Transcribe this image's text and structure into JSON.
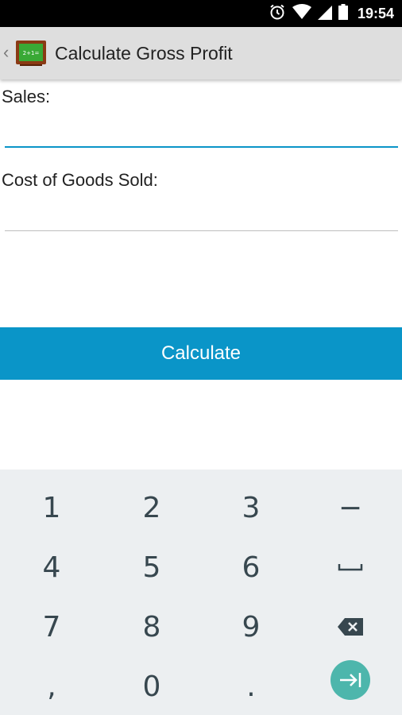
{
  "status_bar": {
    "time": "19:54",
    "icons": [
      "alarm-icon",
      "wifi-icon",
      "signal-icon",
      "battery-icon"
    ]
  },
  "action_bar": {
    "title": "Calculate Gross Profit",
    "app_icon_text": "2+1="
  },
  "form": {
    "sales_label": "Sales:",
    "sales_value": "",
    "cogs_label": "Cost of Goods Sold:",
    "cogs_value": "",
    "button_label": "Calculate"
  },
  "keyboard": {
    "keys": [
      "1",
      "2",
      "3",
      "−",
      "4",
      "5",
      "6",
      "space",
      "7",
      "8",
      "9",
      "backspace",
      ",",
      "0",
      ".",
      "next"
    ]
  },
  "colors": {
    "accent": "#0a95c8",
    "enter_key": "#4db6ac",
    "keyboard_bg": "#eceff1",
    "action_bar_bg": "#dedede"
  }
}
